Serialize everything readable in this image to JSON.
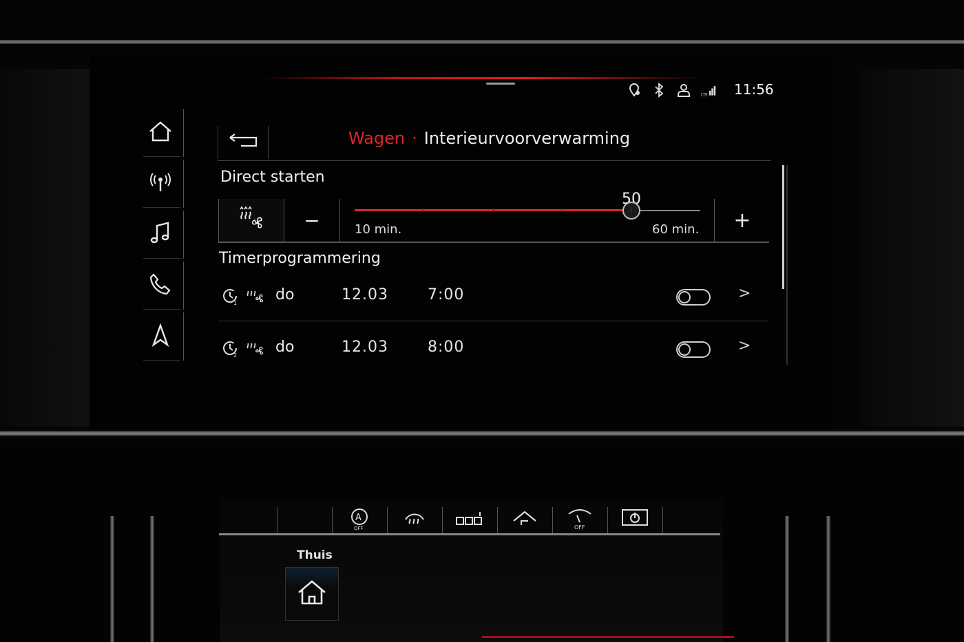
{
  "status_bar": {
    "time": "11:56",
    "icons": [
      "location-pin-icon",
      "bluetooth-icon",
      "user-profile-icon",
      "lte-signal-icon"
    ]
  },
  "side_nav": [
    {
      "name": "home",
      "icon": "home-icon"
    },
    {
      "name": "radio",
      "icon": "radio-antenna-icon"
    },
    {
      "name": "media",
      "icon": "music-note-icon"
    },
    {
      "name": "phone",
      "icon": "phone-icon"
    },
    {
      "name": "navigation",
      "icon": "navigation-arrow-icon"
    }
  ],
  "header": {
    "parent": "Wagen",
    "separator": "·",
    "current": "Interieurvoorverwarming"
  },
  "direct_start": {
    "title": "Direct starten",
    "minus_label": "−",
    "plus_label": "+",
    "slider": {
      "value": "50",
      "min_label": "10 min.",
      "max_label": "60 min.",
      "min": 10,
      "max": 60,
      "current": 50
    }
  },
  "timer": {
    "title": "Timerprogrammering",
    "rows": [
      {
        "timer_no": "1",
        "day": "do",
        "date": "12.03",
        "time": "7:00",
        "enabled": false,
        "chevron": ">"
      },
      {
        "timer_no": "2",
        "day": "do",
        "date": "12.03",
        "time": "8:00",
        "enabled": false,
        "chevron": ">"
      }
    ]
  },
  "lower_console": {
    "controls": [
      "auto-off-icon",
      "defrost-icon",
      "parking-sensors-icon",
      "home-return-icon",
      "wiper-off-icon",
      "screen-power-icon"
    ],
    "home_label": "Thuis"
  },
  "colors": {
    "accent_red": "#d8262d",
    "text": "#ececec",
    "background": "#020202"
  }
}
